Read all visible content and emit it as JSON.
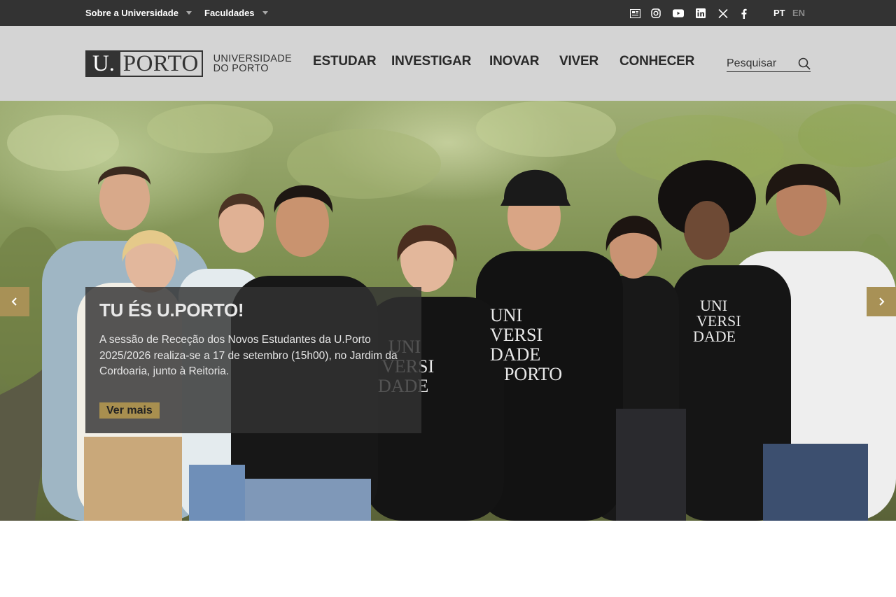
{
  "topbar": {
    "menu": [
      {
        "label": "Sobre a Universidade"
      },
      {
        "label": "Faculdades"
      }
    ],
    "social_icons": [
      "news-icon",
      "instagram-icon",
      "youtube-icon",
      "linkedin-icon",
      "x-icon",
      "facebook-icon"
    ],
    "languages": [
      {
        "label": "PT",
        "active": true
      },
      {
        "label": "EN",
        "active": false
      }
    ]
  },
  "header": {
    "logo": {
      "u": "U.",
      "porto": "PORTO",
      "line1": "UNIVERSIDADE",
      "line2": "DO PORTO"
    },
    "nav": [
      {
        "label": "ESTUDAR"
      },
      {
        "label": "INVESTIGAR"
      },
      {
        "label": "INOVAR"
      },
      {
        "label": "VIVER"
      },
      {
        "label": "CONHECER"
      }
    ],
    "search": {
      "placeholder": "Pesquisar"
    }
  },
  "hero": {
    "title": "TU ÉS U.PORTO!",
    "text": "A sessão de Receção dos Novos Estudantes da U.Porto 2025/2026 realiza-se a 17 de setembro (15h00), no Jardim da Cordoaria, junto à Reitoria.",
    "button": "Ver mais"
  },
  "colors": {
    "topbar": "#333333",
    "header": "#d4d4d4",
    "accent": "#a88f4f"
  }
}
